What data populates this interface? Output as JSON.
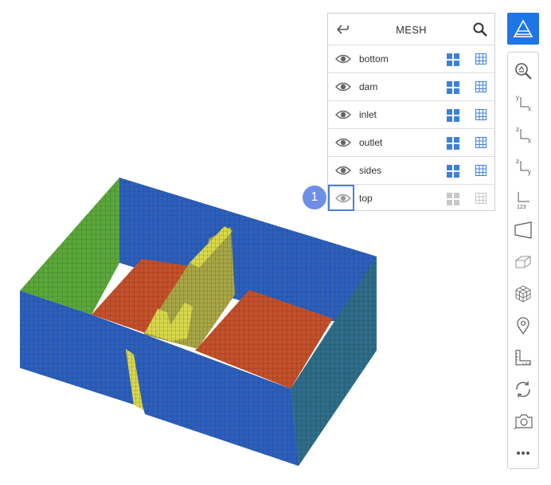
{
  "mesh_panel": {
    "title": "MESH",
    "regions": [
      {
        "label": "bottom",
        "visible": true
      },
      {
        "label": "dam",
        "visible": true
      },
      {
        "label": "inlet",
        "visible": true
      },
      {
        "label": "outlet",
        "visible": true
      },
      {
        "label": "sides",
        "visible": true
      },
      {
        "label": "top",
        "visible": false
      }
    ]
  },
  "callout": {
    "number": "1"
  },
  "toolbar": {
    "axis_labels": {
      "yx": [
        "y",
        "x"
      ],
      "zx": [
        "z",
        "x"
      ],
      "zy": [
        "z",
        "y"
      ],
      "iso": "123"
    }
  },
  "colors": {
    "accent": "#1f74e6",
    "icon_active": "#3d7fe0",
    "icon_inactive": "#c8c8c8",
    "callout": "#6f8fe6",
    "mesh_blue": "#2e5fb8",
    "mesh_green": "#5aa83a",
    "mesh_red": "#c2502a",
    "mesh_yellow": "#d8d84a"
  }
}
